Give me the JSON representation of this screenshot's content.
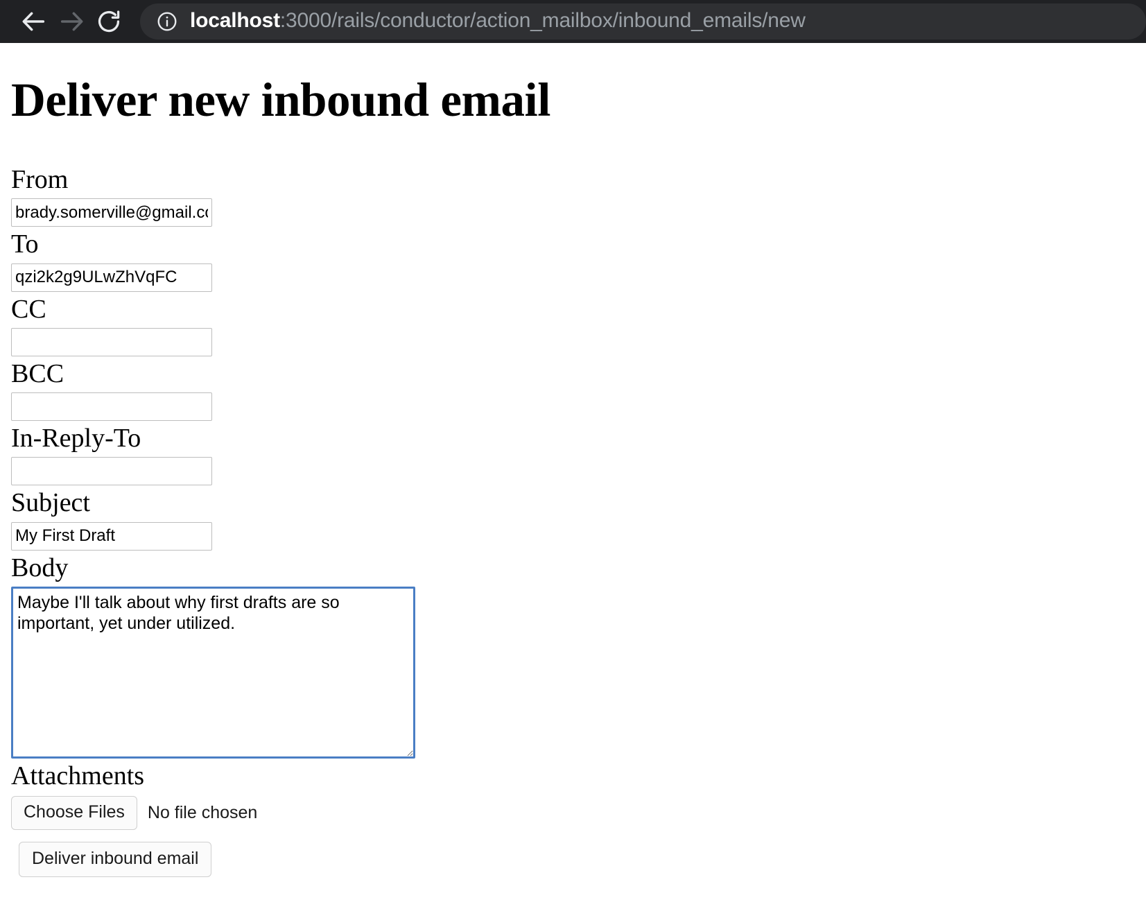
{
  "browser": {
    "back_icon": "arrow-left-icon",
    "forward_icon": "arrow-right-icon",
    "reload_icon": "reload-icon",
    "site_info_icon": "info-circle-icon",
    "url_host": "localhost",
    "url_rest": ":3000/rails/conductor/action_mailbox/inbound_emails/new",
    "chrome_bg": "#202124",
    "omnibox_bg": "#2f3033",
    "host_color": "#ffffff",
    "path_color": "#9aa0a6"
  },
  "page": {
    "title": "Deliver new inbound email"
  },
  "form": {
    "fields": [
      {
        "label": "From",
        "value": "brady.somerville@gmail.com",
        "placeholder": ""
      },
      {
        "label": "To",
        "value": "qzi2k2g9ULwZhVqFC",
        "placeholder": ""
      },
      {
        "label": "CC",
        "value": "",
        "placeholder": ""
      },
      {
        "label": "BCC",
        "value": "",
        "placeholder": ""
      },
      {
        "label": "In-Reply-To",
        "value": "",
        "placeholder": ""
      },
      {
        "label": "Subject",
        "value": "My First Draft",
        "placeholder": ""
      }
    ],
    "body": {
      "label": "Body",
      "value": "Maybe I'll talk about why first drafts are so important, yet under utilized.",
      "focus_border_color": "#4a7ec4"
    },
    "attachments": {
      "label": "Attachments",
      "choose_files_label": "Choose Files",
      "no_file_text": "No file chosen"
    },
    "submit_label": "Deliver inbound email"
  }
}
